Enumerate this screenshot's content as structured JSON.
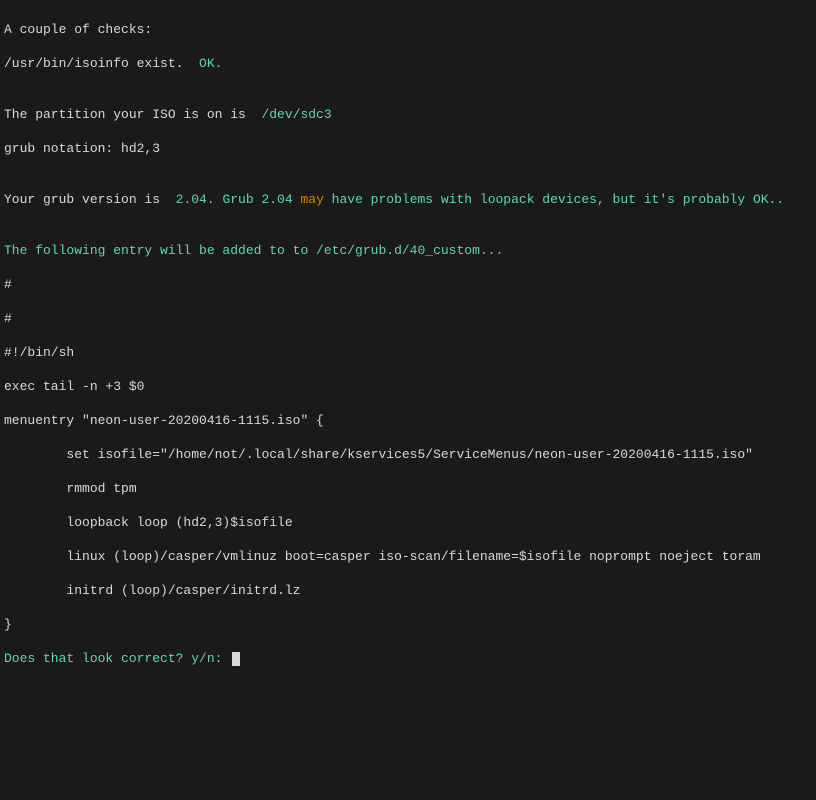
{
  "lines": {
    "l1": "A couple of checks:",
    "l2a": "/usr/bin/isoinfo exist.  ",
    "l2b": "OK.",
    "l3": "",
    "l4a": "The partition your ISO is on is  ",
    "l4b": "/dev/sdc3",
    "l5": "grub notation: hd2,3",
    "l6": "",
    "l7a": "Your grub version is  ",
    "l7b": "2.04. Grub 2.04 ",
    "l7c": "may",
    "l7d": " have problems with loopack devices, but it's probably OK..",
    "l8": "",
    "l9": "The following entry will be added to to /etc/grub.d/40_custom...",
    "l10": "#",
    "l11": "#",
    "l12": "#!/bin/sh",
    "l13": "exec tail -n +3 $0",
    "l14": "menuentry \"neon-user-20200416-1115.iso\" {",
    "l15": "        set isofile=\"/home/not/.local/share/kservices5/ServiceMenus/neon-user-20200416-1115.iso\"",
    "l16": "        rmmod tpm",
    "l17": "        loopback loop (hd2,3)$isofile",
    "l18": "        linux (loop)/casper/vmlinuz boot=casper iso-scan/filename=$isofile noprompt noeject toram",
    "l19": "        initrd (loop)/casper/initrd.lz",
    "l20": "}",
    "prompt": "Does that look correct? y/n: "
  }
}
